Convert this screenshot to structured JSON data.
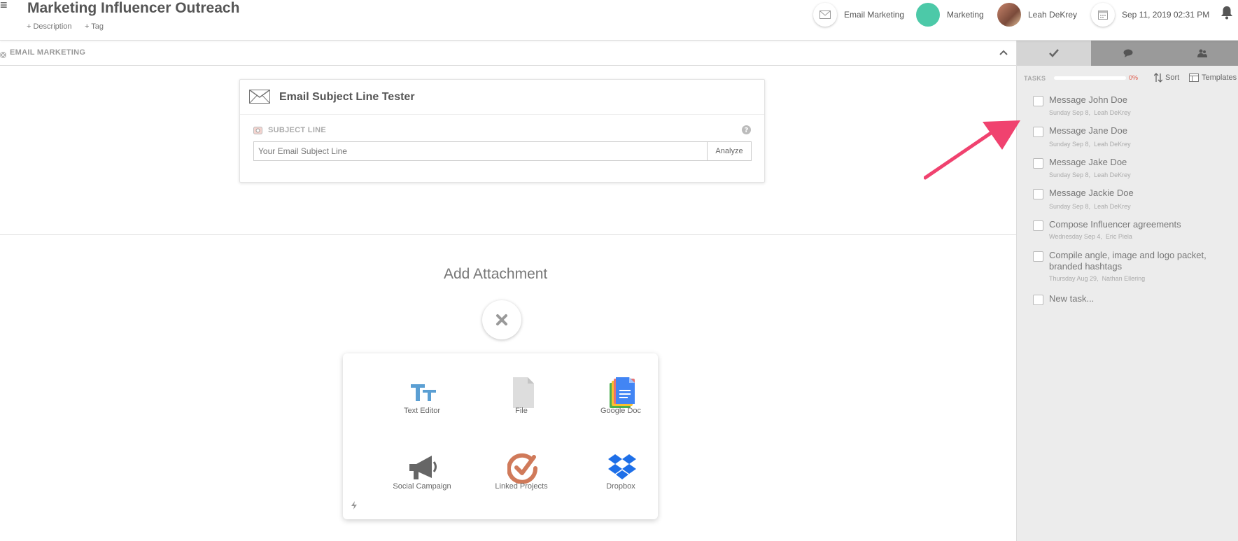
{
  "header": {
    "title": "Marketing Influencer Outreach",
    "description_link": "+ Description",
    "tag_link": "+ Tag",
    "channel": "Email Marketing",
    "team": "Marketing",
    "user": "Leah DeKrey",
    "date": "Sep 11, 2019 02:31 PM"
  },
  "section": {
    "label": "EMAIL MARKETING"
  },
  "tester": {
    "title": "Email Subject Line Tester",
    "subject_label": "SUBJECT LINE",
    "input_placeholder": "Your Email Subject Line",
    "analyze_label": "Analyze"
  },
  "attachment": {
    "title": "Add Attachment",
    "options": [
      {
        "label": "Text Editor",
        "icon": "text-editor-icon"
      },
      {
        "label": "File",
        "icon": "file-icon"
      },
      {
        "label": "Google Doc",
        "icon": "google-doc-icon"
      },
      {
        "label": "Social Campaign",
        "icon": "megaphone-icon"
      },
      {
        "label": "Linked Projects",
        "icon": "linked-projects-icon"
      },
      {
        "label": "Dropbox",
        "icon": "dropbox-icon"
      }
    ]
  },
  "tasks": {
    "label": "TASKS",
    "progress_percent": 0,
    "progress_text": "0%",
    "sort_label": "Sort",
    "templates_label": "Templates",
    "items": [
      {
        "title": "Message John Doe",
        "date": "Sunday Sep 8,",
        "assignee": "Leah DeKrey"
      },
      {
        "title": "Message Jane Doe",
        "date": "Sunday Sep 8,",
        "assignee": "Leah DeKrey"
      },
      {
        "title": "Message Jake Doe",
        "date": "Sunday Sep 8,",
        "assignee": "Leah DeKrey"
      },
      {
        "title": "Message Jackie Doe",
        "date": "Sunday Sep 8,",
        "assignee": "Leah DeKrey"
      },
      {
        "title": "Compose Influencer agreements",
        "date": "Wednesday Sep 4,",
        "assignee": "Eric Piela"
      },
      {
        "title": "Compile angle, image and logo packet, branded hashtags",
        "date": "Thursday Aug 29,",
        "assignee": "Nathan Ellering"
      }
    ],
    "new_task_label": "New task..."
  },
  "colors": {
    "accent_teal": "#4cc9a8",
    "progress_red": "#e05a4a",
    "arrow_pink": "#f0426f"
  }
}
